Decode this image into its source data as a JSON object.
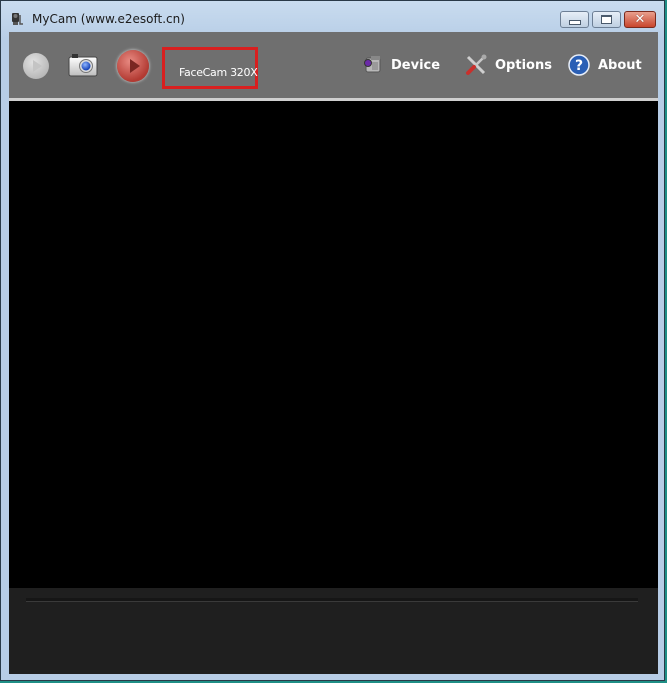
{
  "window": {
    "title": "MyCam (www.e2esoft.cn)",
    "app_icon": "webcam-icon",
    "controls": {
      "minimize": "minimize-icon",
      "maximize": "maximize-icon",
      "close": "close-icon",
      "close_glyph": "✕"
    }
  },
  "toolbar": {
    "play": {
      "icon": "play-icon",
      "enabled": false
    },
    "snapshot": {
      "icon": "camera-icon"
    },
    "record": {
      "icon": "record-icon"
    },
    "device_name": "FaceCam 320X",
    "highlight_color": "#d81f1f",
    "menu": [
      {
        "label": "Device",
        "icon": "camcorder-icon"
      },
      {
        "label": "Options",
        "icon": "tools-icon"
      },
      {
        "label": "About",
        "icon": "help-icon"
      }
    ]
  },
  "colors": {
    "toolbar_bg": "#6f6f6f",
    "video_bg": "#000000",
    "bottom_bg": "#1f1f1f"
  }
}
